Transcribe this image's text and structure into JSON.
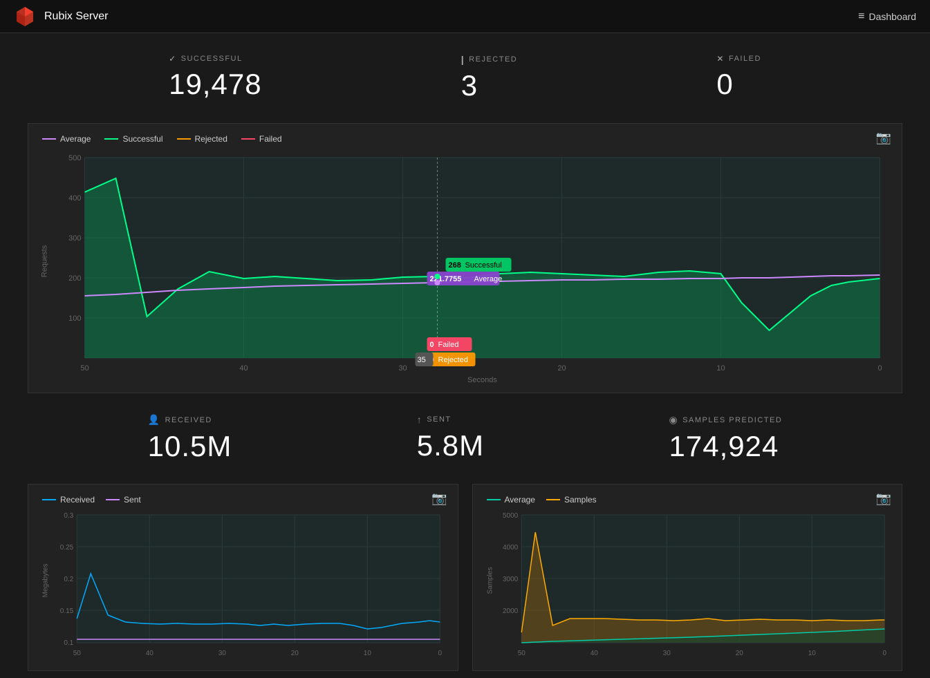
{
  "header": {
    "app_title": "Rubix Server",
    "nav_label": "Dashboard",
    "nav_icon": "≡"
  },
  "stats": {
    "successful": {
      "icon": "✓",
      "label": "SUCCESSFUL",
      "value": "19,478"
    },
    "rejected": {
      "icon": "|",
      "label": "REJECTED",
      "value": "3"
    },
    "failed": {
      "icon": "✕",
      "label": "FAILED",
      "value": "0"
    }
  },
  "main_chart": {
    "legend": [
      {
        "label": "Average",
        "color": "#cc88ff"
      },
      {
        "label": "Successful",
        "color": "#00ff88"
      },
      {
        "label": "Rejected",
        "color": "#ff9900"
      },
      {
        "label": "Failed",
        "color": "#ff4466"
      }
    ],
    "y_label": "Requests",
    "x_label": "Seconds",
    "y_ticks": [
      "500",
      "400",
      "300",
      "200",
      "100"
    ],
    "x_ticks": [
      "50",
      "40",
      "30",
      "20",
      "10",
      "0"
    ],
    "tooltip": {
      "successful_val": "268",
      "successful_label": "Successful",
      "average_val": "221.7755",
      "average_label": "Average",
      "failed_val": "0",
      "failed_label": "Failed",
      "rejected_val": "0",
      "rejected_label": "Rejected",
      "x_val": "35"
    }
  },
  "bottom_stats": {
    "received": {
      "icon": "↓",
      "label": "RECEIVED",
      "value": "10.5M"
    },
    "sent": {
      "icon": "↑",
      "label": "SENT",
      "value": "5.8M"
    },
    "samples": {
      "icon": "◉",
      "label": "SAMPLES PREDICTED",
      "value": "174,924"
    }
  },
  "bandwidth_chart": {
    "legend": [
      {
        "label": "Received",
        "color": "#00aaff"
      },
      {
        "label": "Sent",
        "color": "#cc88ff"
      }
    ],
    "y_label": "Megabytes",
    "y_ticks": [
      "0.3",
      "0.25",
      "0.2",
      "0.15",
      "0.1"
    ],
    "x_ticks": [
      "50",
      "40",
      "30",
      "20",
      "10",
      "0"
    ]
  },
  "samples_chart": {
    "legend": [
      {
        "label": "Average",
        "color": "#00ccaa"
      },
      {
        "label": "Samples",
        "color": "#ffaa00"
      }
    ],
    "y_label": "Samples",
    "y_ticks": [
      "5000",
      "4000",
      "3000",
      "2000"
    ],
    "x_ticks": [
      "50",
      "40",
      "30",
      "20",
      "10",
      "0"
    ]
  }
}
